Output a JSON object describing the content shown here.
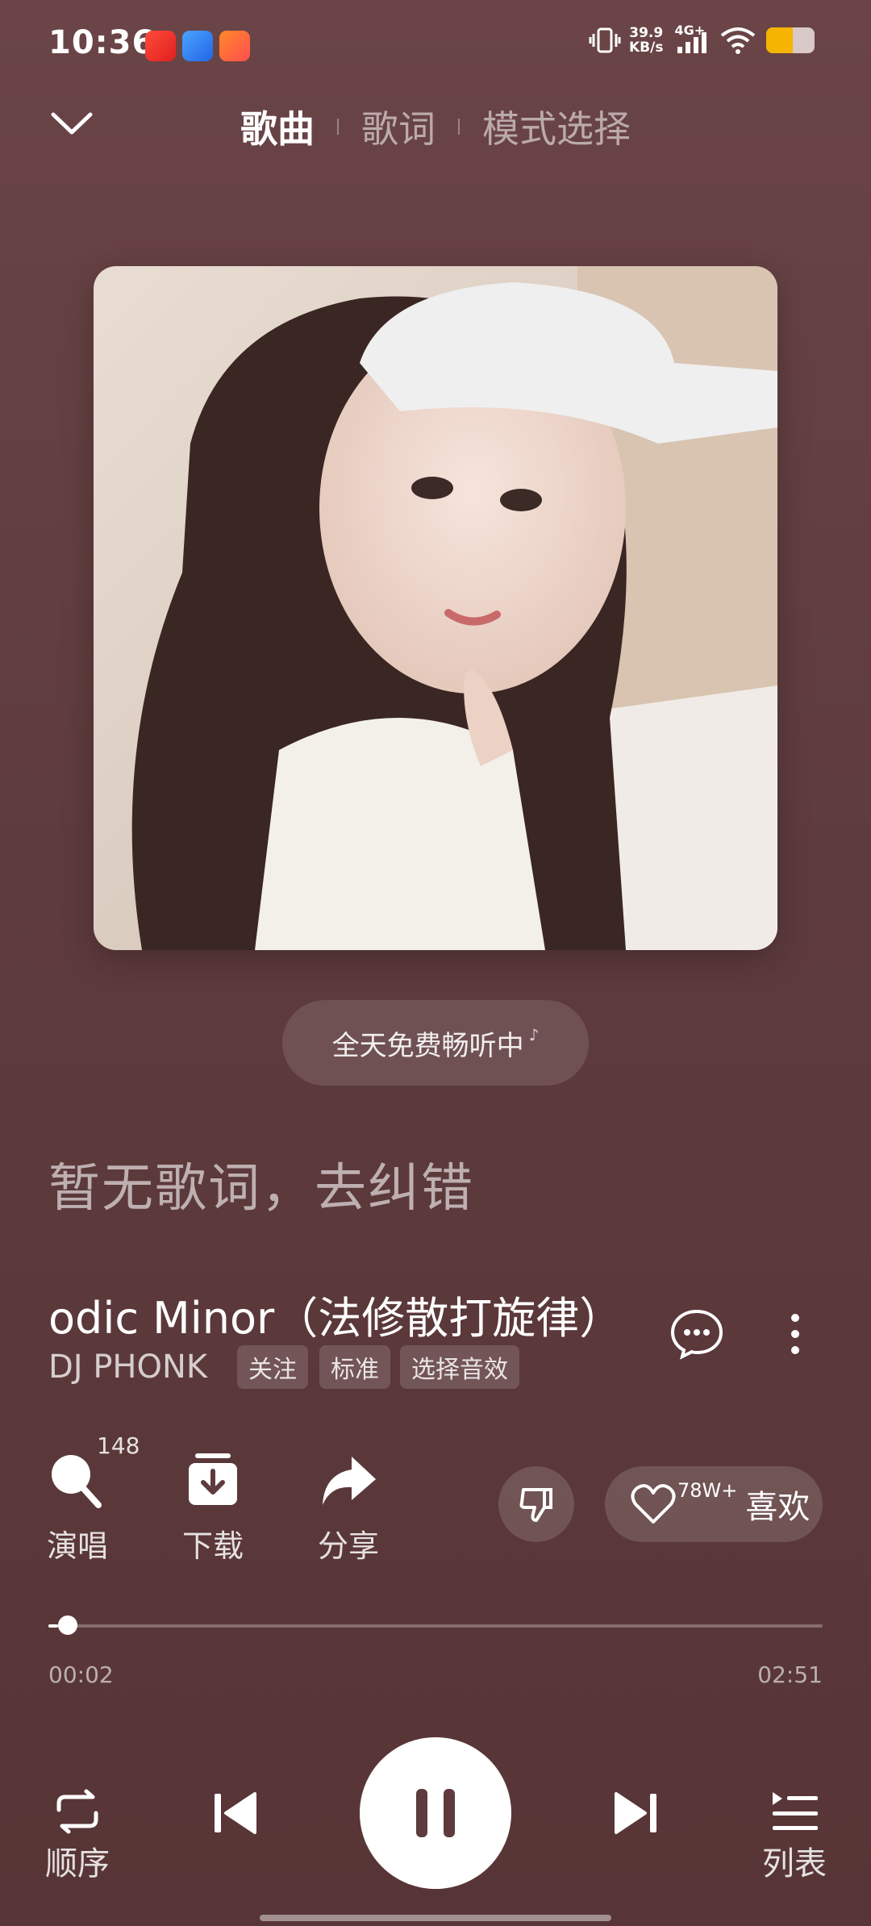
{
  "status_bar": {
    "time": "10:36",
    "net_speed_value": "39.9",
    "net_speed_unit": "KB/s",
    "network": "4G+",
    "battery_level": 0.55,
    "icons": [
      "app-icon-red",
      "app-icon-blue",
      "app-icon-orange",
      "vibrate-icon",
      "signal-icon",
      "wifi-icon",
      "battery-icon"
    ]
  },
  "header": {
    "tabs": [
      {
        "label": "歌曲",
        "active": true
      },
      {
        "label": "歌词",
        "active": false
      },
      {
        "label": "模式选择",
        "active": false
      }
    ]
  },
  "banner": {
    "free_listen": "全天免费畅听中"
  },
  "lyrics": {
    "empty_text": "暂无歌词，去纠错"
  },
  "song": {
    "title": "odic Minor（法修散打旋律）",
    "artist": "DJ PHONK",
    "tags": [
      "关注",
      "标准",
      "选择音效"
    ]
  },
  "actions": {
    "sing": {
      "label": "演唱",
      "count": "148"
    },
    "download": {
      "label": "下载"
    },
    "share": {
      "label": "分享"
    },
    "like": {
      "label": "喜欢",
      "count": "78W+"
    }
  },
  "progress": {
    "current": "00:02",
    "total": "02:51",
    "fraction": 0.012
  },
  "controls": {
    "mode_label": "顺序",
    "playlist_label": "列表"
  },
  "colors": {
    "background": "#5e3b3d",
    "accent": "#ffffff",
    "battery": "#f4b400"
  }
}
